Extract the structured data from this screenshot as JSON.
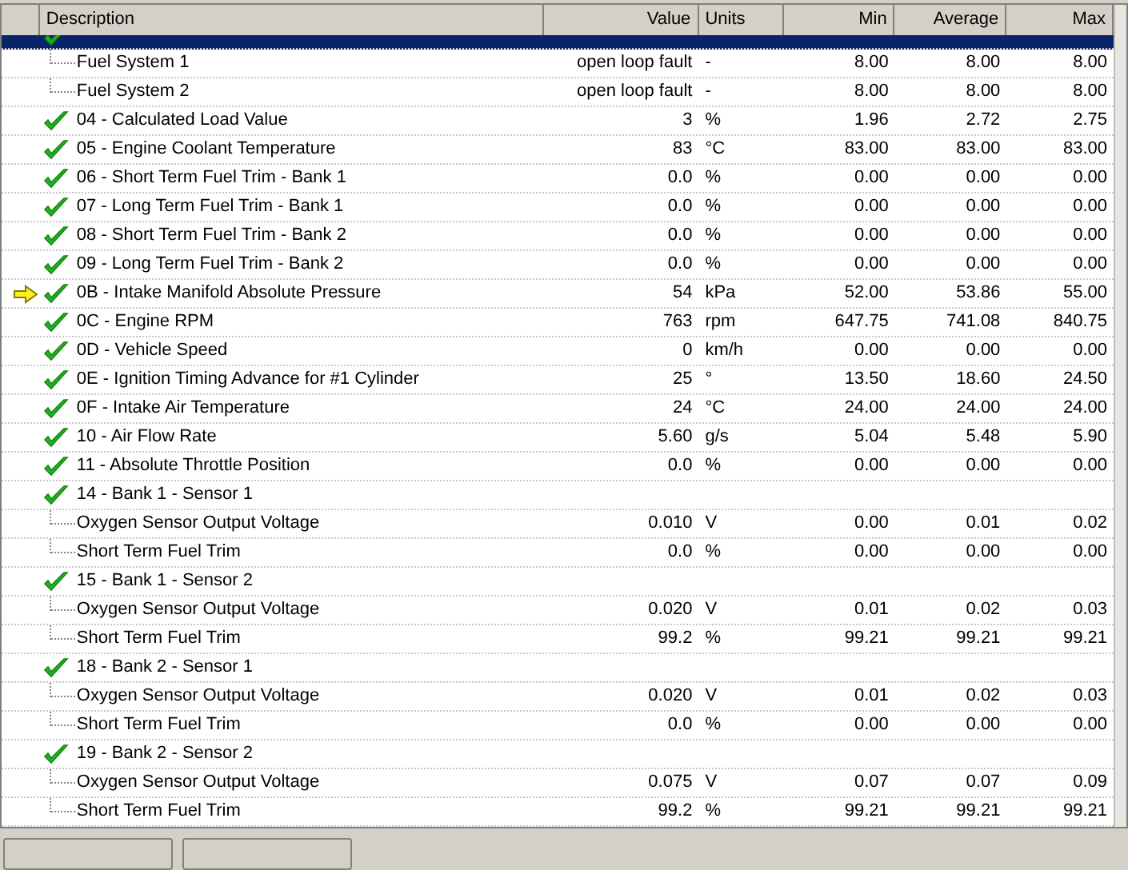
{
  "table": {
    "columns": [
      "Description",
      "Value",
      "Units",
      "Min",
      "Average",
      "Max"
    ],
    "rows": [
      {
        "kind": "pid",
        "selected": true,
        "current": false
      },
      {
        "kind": "sub",
        "description": "Fuel System 1",
        "value": "open loop fault",
        "units": "-",
        "min": "8.00",
        "average": "8.00",
        "max": "8.00",
        "selected": false,
        "current": false
      },
      {
        "kind": "sub",
        "description": "Fuel System 2",
        "value": "open loop fault",
        "units": "-",
        "min": "8.00",
        "average": "8.00",
        "max": "8.00",
        "selected": false,
        "current": false
      },
      {
        "kind": "pid",
        "description": "04 - Calculated Load Value",
        "value": "3",
        "units": "%",
        "min": "1.96",
        "average": "2.72",
        "max": "2.75",
        "selected": false,
        "current": false
      },
      {
        "kind": "pid",
        "description": "05 - Engine Coolant Temperature",
        "value": "83",
        "units": "°C",
        "min": "83.00",
        "average": "83.00",
        "max": "83.00",
        "selected": false,
        "current": false
      },
      {
        "kind": "pid",
        "description": "06 - Short Term Fuel Trim - Bank 1",
        "value": "0.0",
        "units": "%",
        "min": "0.00",
        "average": "0.00",
        "max": "0.00",
        "selected": false,
        "current": false
      },
      {
        "kind": "pid",
        "description": "07 - Long Term Fuel Trim - Bank 1",
        "value": "0.0",
        "units": "%",
        "min": "0.00",
        "average": "0.00",
        "max": "0.00",
        "selected": false,
        "current": false
      },
      {
        "kind": "pid",
        "description": "08 - Short Term Fuel Trim - Bank 2",
        "value": "0.0",
        "units": "%",
        "min": "0.00",
        "average": "0.00",
        "max": "0.00",
        "selected": false,
        "current": false
      },
      {
        "kind": "pid",
        "description": "09 - Long Term Fuel Trim - Bank 2",
        "value": "0.0",
        "units": "%",
        "min": "0.00",
        "average": "0.00",
        "max": "0.00",
        "selected": false,
        "current": false
      },
      {
        "kind": "pid",
        "description": "0B - Intake Manifold Absolute Pressure",
        "value": "54",
        "units": "kPa",
        "min": "52.00",
        "average": "53.86",
        "max": "55.00",
        "selected": false,
        "current": true
      },
      {
        "kind": "pid",
        "description": "0C - Engine RPM",
        "value": "763",
        "units": "rpm",
        "min": "647.75",
        "average": "741.08",
        "max": "840.75",
        "selected": false,
        "current": false
      },
      {
        "kind": "pid",
        "description": "0D - Vehicle Speed",
        "value": "0",
        "units": "km/h",
        "min": "0.00",
        "average": "0.00",
        "max": "0.00",
        "selected": false,
        "current": false
      },
      {
        "kind": "pid",
        "description": "0E - Ignition Timing Advance for #1 Cylinder",
        "value": "25",
        "units": "°",
        "min": "13.50",
        "average": "18.60",
        "max": "24.50",
        "selected": false,
        "current": false
      },
      {
        "kind": "pid",
        "description": "0F - Intake Air Temperature",
        "value": "24",
        "units": "°C",
        "min": "24.00",
        "average": "24.00",
        "max": "24.00",
        "selected": false,
        "current": false
      },
      {
        "kind": "pid",
        "description": "10 - Air Flow Rate",
        "value": "5.60",
        "units": "g/s",
        "min": "5.04",
        "average": "5.48",
        "max": "5.90",
        "selected": false,
        "current": false
      },
      {
        "kind": "pid",
        "description": "11 - Absolute Throttle Position",
        "value": "0.0",
        "units": "%",
        "min": "0.00",
        "average": "0.00",
        "max": "0.00",
        "selected": false,
        "current": false
      },
      {
        "kind": "pid",
        "description": "14 - Bank 1 - Sensor 1",
        "selected": false,
        "current": false
      },
      {
        "kind": "sub",
        "description": "Oxygen Sensor Output Voltage",
        "value": "0.010",
        "units": "V",
        "min": "0.00",
        "average": "0.01",
        "max": "0.02",
        "selected": false,
        "current": false
      },
      {
        "kind": "sub",
        "description": "Short Term Fuel Trim",
        "value": "0.0",
        "units": "%",
        "min": "0.00",
        "average": "0.00",
        "max": "0.00",
        "selected": false,
        "current": false
      },
      {
        "kind": "pid",
        "description": "15 - Bank 1 - Sensor 2",
        "selected": false,
        "current": false
      },
      {
        "kind": "sub",
        "description": "Oxygen Sensor Output Voltage",
        "value": "0.020",
        "units": "V",
        "min": "0.01",
        "average": "0.02",
        "max": "0.03",
        "selected": false,
        "current": false
      },
      {
        "kind": "sub",
        "description": "Short Term Fuel Trim",
        "value": "99.2",
        "units": "%",
        "min": "99.21",
        "average": "99.21",
        "max": "99.21",
        "selected": false,
        "current": false
      },
      {
        "kind": "pid",
        "description": "18 - Bank 2 - Sensor 1",
        "selected": false,
        "current": false
      },
      {
        "kind": "sub",
        "description": "Oxygen Sensor Output Voltage",
        "value": "0.020",
        "units": "V",
        "min": "0.01",
        "average": "0.02",
        "max": "0.03",
        "selected": false,
        "current": false
      },
      {
        "kind": "sub",
        "description": "Short Term Fuel Trim",
        "value": "0.0",
        "units": "%",
        "min": "0.00",
        "average": "0.00",
        "max": "0.00",
        "selected": false,
        "current": false
      },
      {
        "kind": "pid",
        "description": "19 - Bank 2 - Sensor 2",
        "selected": false,
        "current": false
      },
      {
        "kind": "sub",
        "description": "Oxygen Sensor Output Voltage",
        "value": "0.075",
        "units": "V",
        "min": "0.07",
        "average": "0.07",
        "max": "0.09",
        "selected": false,
        "current": false
      },
      {
        "kind": "sub",
        "description": "Short Term Fuel Trim",
        "value": "99.2",
        "units": "%",
        "min": "99.21",
        "average": "99.21",
        "max": "99.21",
        "selected": false,
        "current": false
      }
    ]
  }
}
